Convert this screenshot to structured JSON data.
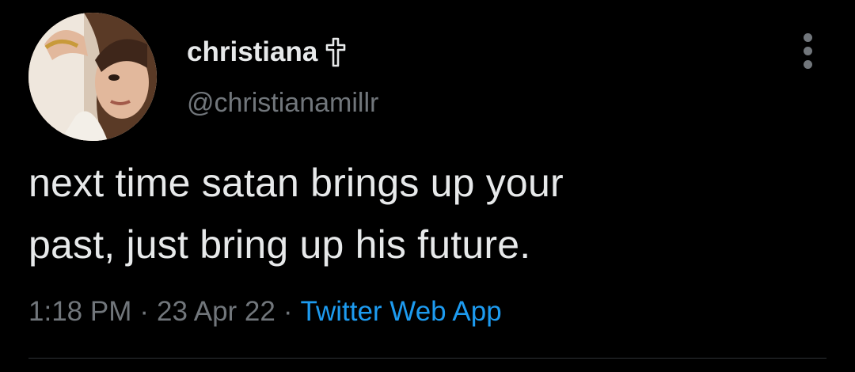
{
  "tweet": {
    "display_name": "christiana",
    "badge_glyph": "✝",
    "handle": "@christianamillr",
    "text_line1": "next time satan brings up your",
    "text_line2": "past, just bring up his future.",
    "time": "1:18 PM",
    "date": "23 Apr 22",
    "separator": "·",
    "source": "Twitter Web App"
  },
  "icons": {
    "avatar": "profile-photo",
    "badge": "cross-icon",
    "more": "more-options-icon"
  },
  "colors": {
    "background": "#000000",
    "primary_text": "#e7e9ea",
    "secondary_text": "#71767b",
    "link": "#1d9bf0",
    "divider": "#2f3336"
  }
}
